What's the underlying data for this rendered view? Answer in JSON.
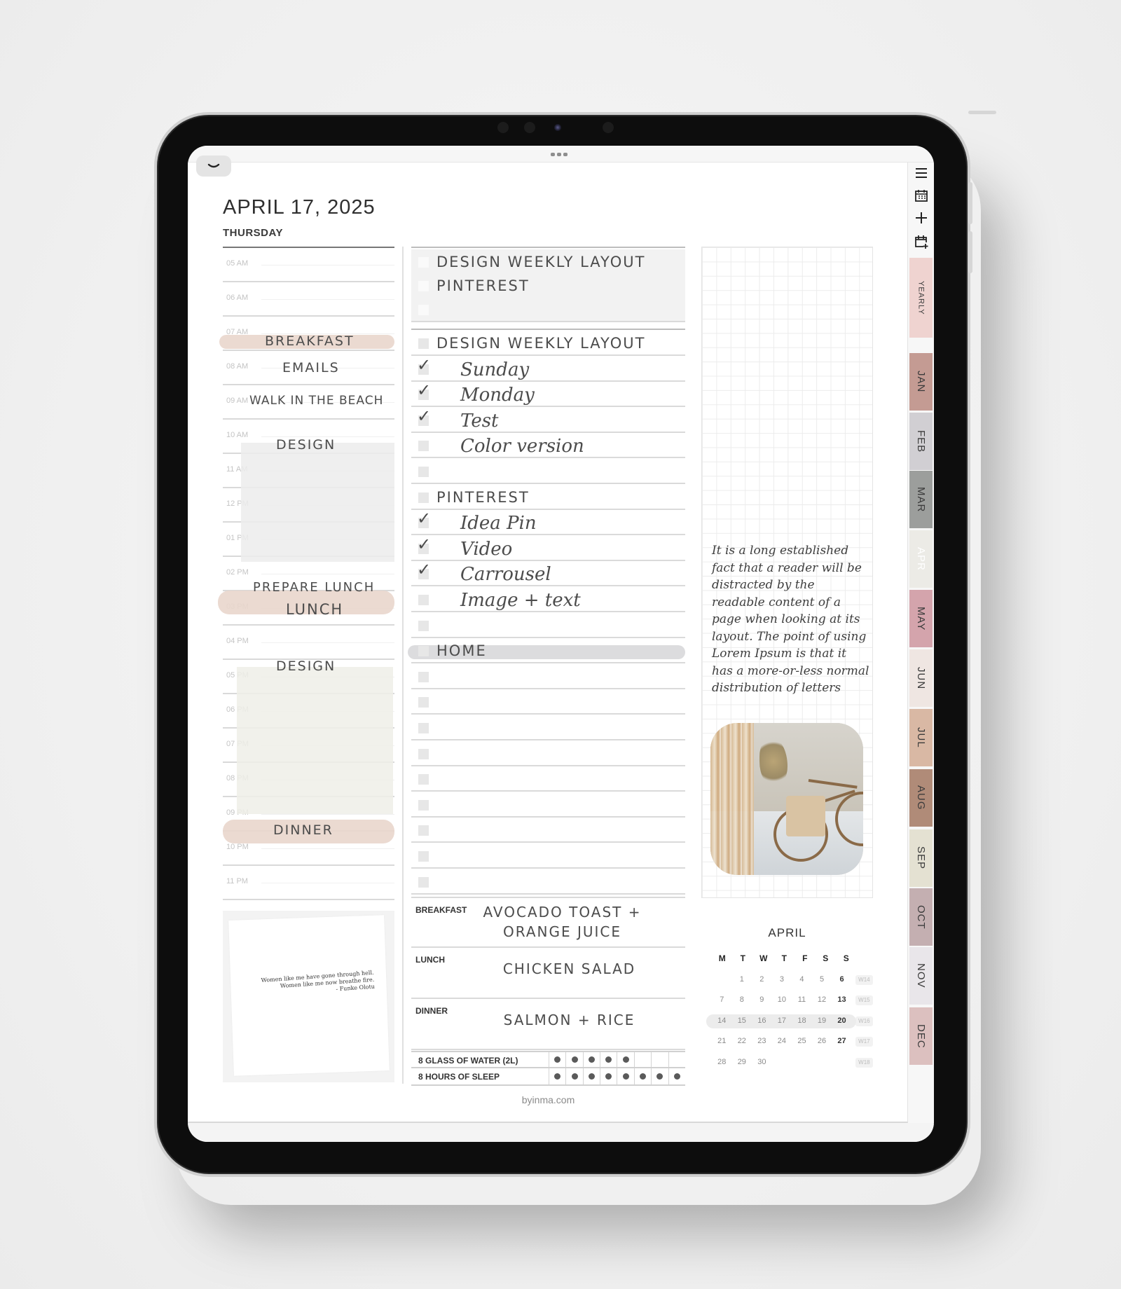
{
  "header": {
    "date": "APRIL 17, 2025",
    "weekday": "THURSDAY"
  },
  "toolbar": {
    "collapse_icon": "chevron-down-icon",
    "more_icon": "more-dots-icon"
  },
  "sidebar": {
    "icons": [
      {
        "name": "menu-icon",
        "glyph": "☰"
      },
      {
        "name": "calendar-icon",
        "glyph": "▦"
      },
      {
        "name": "add-icon",
        "glyph": "+"
      },
      {
        "name": "calendar-add-icon",
        "glyph": "⊞"
      }
    ],
    "tabs": [
      {
        "label": "YEARLY",
        "color": "#efd3d0"
      },
      {
        "label": "JAN",
        "color": "#c49b93"
      },
      {
        "label": "FEB",
        "color": "#d1cfd3"
      },
      {
        "label": "MAR",
        "color": "#9c9e9c"
      },
      {
        "label": "APR",
        "color": "#ecebe6"
      },
      {
        "label": "MAY",
        "color": "#d4a4ac"
      },
      {
        "label": "JUN",
        "color": "#efe6e2"
      },
      {
        "label": "JUL",
        "color": "#d9b8a4"
      },
      {
        "label": "AUG",
        "color": "#b08b78"
      },
      {
        "label": "SEP",
        "color": "#e4e1d2"
      },
      {
        "label": "OCT",
        "color": "#c4afb1"
      },
      {
        "label": "NOV",
        "color": "#e9e6ea"
      },
      {
        "label": "DEC",
        "color": "#dcc0bf"
      }
    ]
  },
  "schedule": {
    "hours": [
      "05 AM",
      "06 AM",
      "07 AM",
      "08 AM",
      "09 AM",
      "10 AM",
      "11 AM",
      "12 PM",
      "01 PM",
      "02 PM",
      "03 PM",
      "04 PM",
      "05 PM",
      "06 PM",
      "07 PM",
      "08 PM",
      "09 PM",
      "10 PM",
      "11 PM"
    ],
    "entries": {
      "breakfast": "BREAKFAST",
      "emails": "EMAILS",
      "walk": "WALK IN THE BEACH",
      "design_am": "DESIGN",
      "prepare_lunch": "PREPARE LUNCH",
      "lunch": "LUNCH",
      "design_pm": "DESIGN",
      "dinner": "DINNER"
    }
  },
  "quote": {
    "line1": "Women like me have gone through hell.",
    "line2": "Women like me now breathe fire.",
    "author": "- Funke Olotu"
  },
  "priorities": [
    {
      "text": "DESIGN WEEKLY LAYOUT",
      "checked": false
    },
    {
      "text": "PINTEREST",
      "checked": false
    },
    {
      "text": "",
      "checked": false
    }
  ],
  "tasks": [
    {
      "text": "DESIGN WEEKLY LAYOUT",
      "checked": false,
      "style": "caps"
    },
    {
      "text": "Sunday",
      "checked": true,
      "style": "sub"
    },
    {
      "text": "Monday",
      "checked": true,
      "style": "sub"
    },
    {
      "text": "Test",
      "checked": true,
      "style": "sub"
    },
    {
      "text": "Color version",
      "checked": false,
      "style": "sub"
    },
    {
      "text": "",
      "checked": false,
      "style": "sub"
    },
    {
      "text": "PINTEREST",
      "checked": false,
      "style": "caps"
    },
    {
      "text": "Idea Pin",
      "checked": true,
      "style": "sub"
    },
    {
      "text": "Video",
      "checked": true,
      "style": "sub"
    },
    {
      "text": "Carrousel",
      "checked": true,
      "style": "sub"
    },
    {
      "text": "Image + text",
      "checked": false,
      "style": "sub"
    },
    {
      "text": "",
      "checked": false,
      "style": "sub"
    },
    {
      "text": "HOME",
      "checked": false,
      "style": "caps",
      "highlight": true
    },
    {
      "text": "",
      "checked": false,
      "style": "sub"
    },
    {
      "text": "",
      "checked": false,
      "style": "sub"
    },
    {
      "text": "",
      "checked": false,
      "style": "sub"
    },
    {
      "text": "",
      "checked": false,
      "style": "sub"
    },
    {
      "text": "",
      "checked": false,
      "style": "sub"
    },
    {
      "text": "",
      "checked": false,
      "style": "sub"
    },
    {
      "text": "",
      "checked": false,
      "style": "sub"
    },
    {
      "text": "",
      "checked": false,
      "style": "sub"
    },
    {
      "text": "",
      "checked": false,
      "style": "sub"
    }
  ],
  "meals": [
    {
      "label": "BREAKFAST",
      "value": "AVOCADO TOAST + ORANGE JUICE"
    },
    {
      "label": "LUNCH",
      "value": "CHICKEN SALAD"
    },
    {
      "label": "DINNER",
      "value": "SALMON + RICE"
    }
  ],
  "trackers": [
    {
      "label": "8 GLASS OF WATER (2L)",
      "filled": 5,
      "total": 8
    },
    {
      "label": "8 HOURS OF SLEEP",
      "filled": 8,
      "total": 8
    }
  ],
  "footer": {
    "link": "byinma.com"
  },
  "notes": {
    "text": "It is a long established fact that a reader will be distracted by the readable content of a page when looking at its layout. The point of using Lorem Ipsum is that it has a more-or-less normal distribution of letters"
  },
  "photo": {
    "description": "bicycle-by-window-photo"
  },
  "mini_calendar": {
    "month": "APRIL",
    "weekdays": [
      "M",
      "T",
      "W",
      "T",
      "F",
      "S",
      "S"
    ],
    "weeks": [
      {
        "days": [
          "",
          "1",
          "2",
          "3",
          "4",
          "5",
          "6"
        ],
        "label": "W14"
      },
      {
        "days": [
          "7",
          "8",
          "9",
          "10",
          "11",
          "12",
          "13"
        ],
        "label": "W15"
      },
      {
        "days": [
          "14",
          "15",
          "16",
          "17",
          "18",
          "19",
          "20"
        ],
        "label": "W16",
        "current": true
      },
      {
        "days": [
          "21",
          "22",
          "23",
          "24",
          "25",
          "26",
          "27"
        ],
        "label": "W17"
      },
      {
        "days": [
          "28",
          "29",
          "30",
          "",
          "",
          "",
          ""
        ],
        "label": "W18"
      }
    ]
  }
}
